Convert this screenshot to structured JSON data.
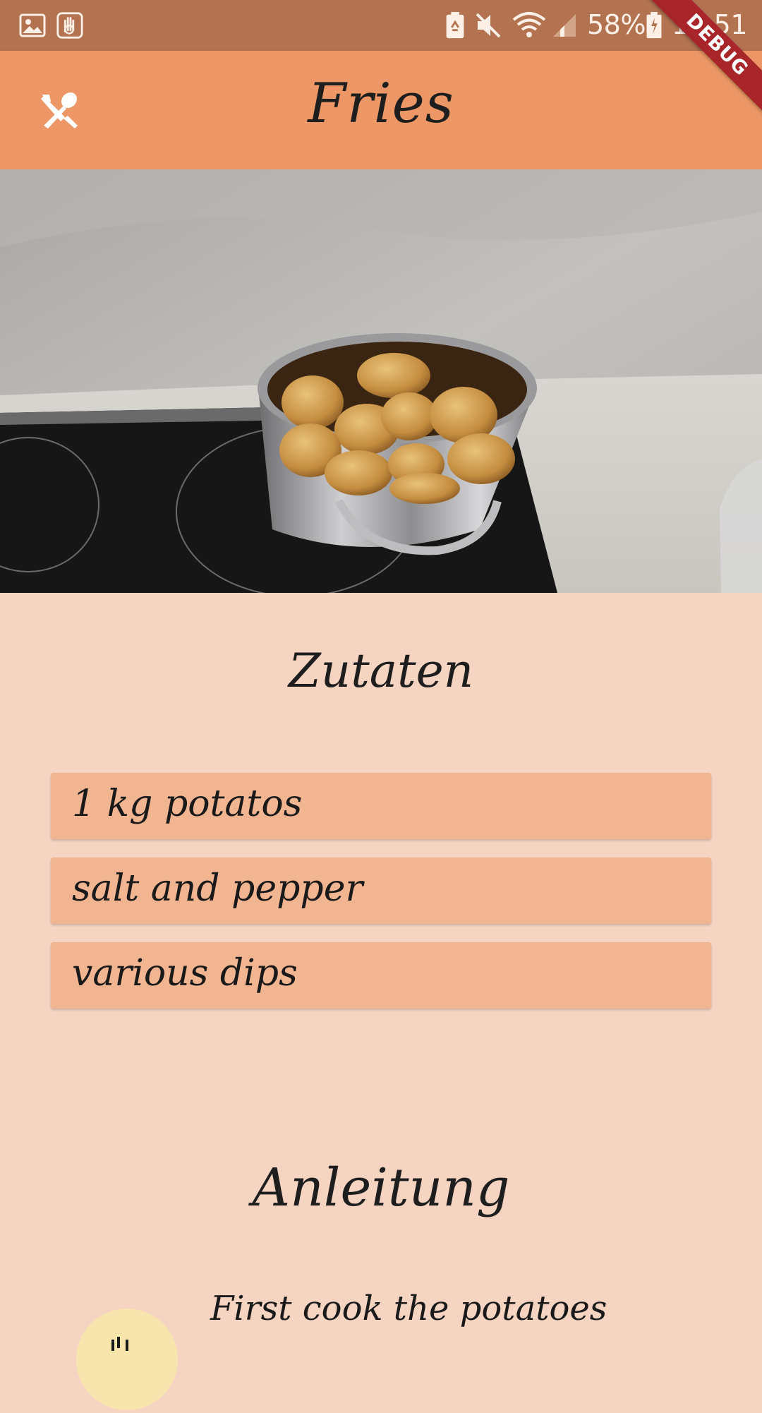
{
  "status_bar": {
    "battery_percent": "58%",
    "time": "10:51",
    "icons": [
      "gallery-icon",
      "hand-icon",
      "battery-saver-icon",
      "mute-icon",
      "wifi-icon",
      "signal-icon",
      "battery-icon"
    ]
  },
  "app_bar": {
    "title": "Fries",
    "icon": "cutlery-icon"
  },
  "debug_banner": {
    "label": "DEBUG"
  },
  "hero": {
    "description_icon": "recipe-photo"
  },
  "ingredients": {
    "title": "Zutaten",
    "items": [
      {
        "label": "1 kg potatos"
      },
      {
        "label": "salt and pepper"
      },
      {
        "label": "various dips"
      }
    ]
  },
  "instructions": {
    "title": "Anleitung",
    "steps": [
      {
        "text": "First cook the potatoes"
      }
    ]
  },
  "colors": {
    "status_bar": "#b47350",
    "app_bar": "#ec9765",
    "background": "#f5d4c1",
    "card": "#f2b591",
    "debug": "#a8262a",
    "avatar": "#f8e4ad"
  }
}
